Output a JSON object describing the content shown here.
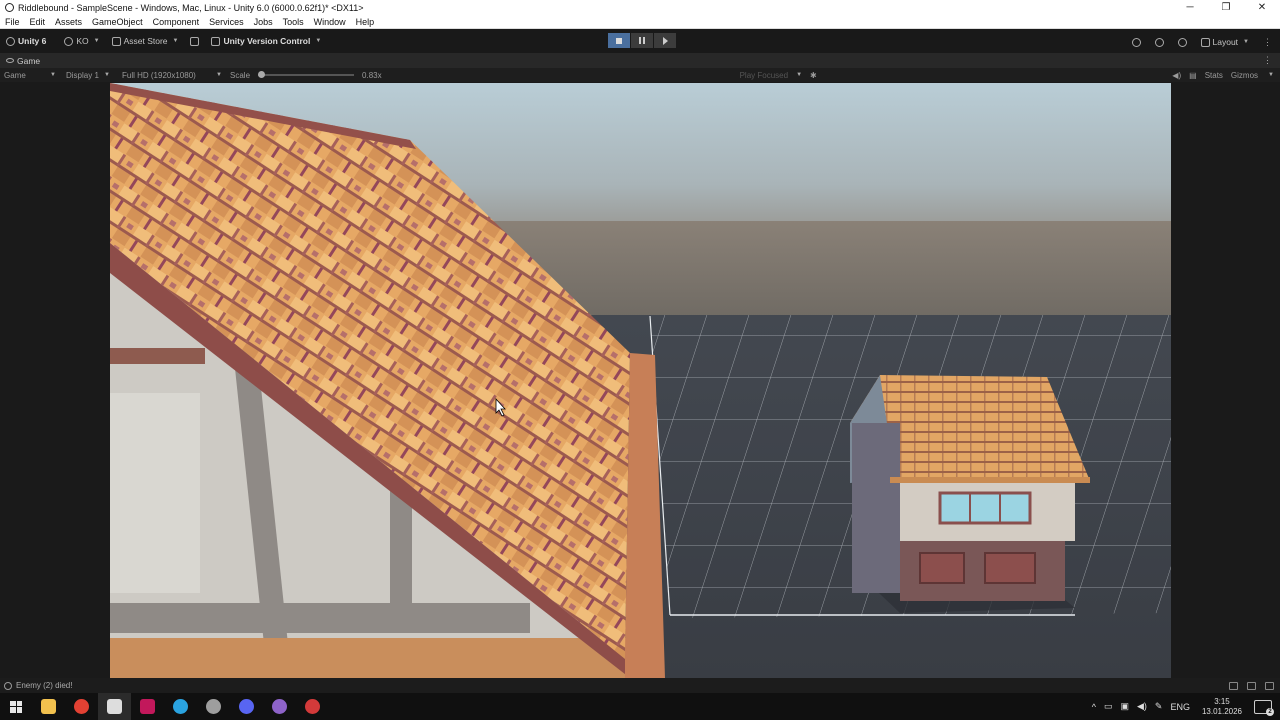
{
  "window": {
    "title": "Riddlebound - SampleScene - Windows, Mac, Linux - Unity 6.0 (6000.0.62f1)* <DX11>",
    "controls": [
      "─",
      "❐",
      "✕"
    ]
  },
  "menu": [
    "File",
    "Edit",
    "Assets",
    "GameObject",
    "Component",
    "Services",
    "Jobs",
    "Tools",
    "Window",
    "Help"
  ],
  "toolbar": {
    "unity_label": "Unity 6",
    "account_label": "KO",
    "asset_store_label": "Asset Store",
    "version_control_label": "Unity Version Control",
    "layout_label": "Layout"
  },
  "game_tab": {
    "label": "Game"
  },
  "game_bar": {
    "view_select": "Game",
    "display_select": "Display 1",
    "resolution_select": "Full HD (1920x1080)",
    "scale_label": "Scale",
    "scale_value": "0.83x",
    "play_mode_select": "Play Focused",
    "stats_label": "Stats",
    "gizmos_label": "Gizmos"
  },
  "status": {
    "message": "Enemy (2) died!"
  },
  "taskbar": {
    "apps": [
      {
        "name": "file-explorer",
        "color": "#f2c14e"
      },
      {
        "name": "chrome",
        "color": "#e34133"
      },
      {
        "name": "unity",
        "color": "#dddddd"
      },
      {
        "name": "jetbrains-rider",
        "color": "#c2185b"
      },
      {
        "name": "telegram",
        "color": "#2aa3e0"
      },
      {
        "name": "cursor",
        "color": "#9e9e9e"
      },
      {
        "name": "discord",
        "color": "#5865f2"
      },
      {
        "name": "github-desktop",
        "color": "#8e63c9"
      },
      {
        "name": "obs",
        "color": "#d33a3a"
      }
    ],
    "language": "ENG",
    "time": "3:15",
    "date": "13.01.2026",
    "notification_count": "2"
  }
}
